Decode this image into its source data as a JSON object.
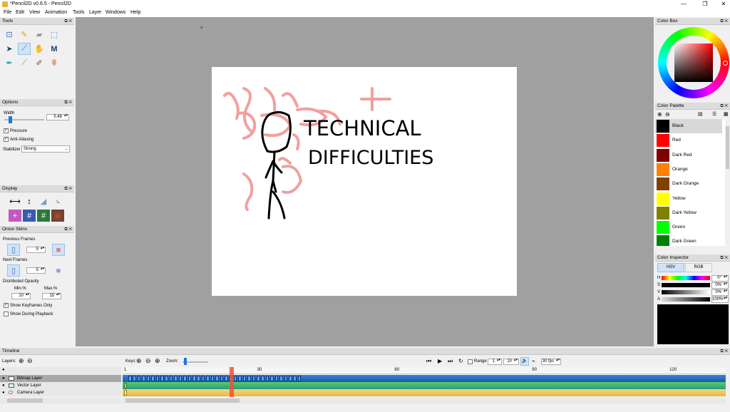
{
  "window": {
    "title": "*Pencil2D v0.6.5 - Pencil2D"
  },
  "menu": [
    "File",
    "Edit",
    "View",
    "Animation",
    "Tools",
    "Layer",
    "Windows",
    "Help"
  ],
  "tools_panel": {
    "title": "Tools"
  },
  "options_panel": {
    "title": "Options",
    "width_label": "Width",
    "width_value": "5.48",
    "width_level": 0.1,
    "pressure_label": "Pressure",
    "pressure_checked": true,
    "antialiasing_label": "Anti-Aliasing",
    "antialiasing_checked": true,
    "stabilizer_label": "Stabilizer",
    "stabilizer_value": "Strong"
  },
  "display_panel": {
    "title": "Display"
  },
  "onion_panel": {
    "title": "Onion Skins",
    "previous_label": "Previous Frames",
    "previous_value": "5",
    "next_label": "Next Frames",
    "next_value": "5",
    "distributed_label": "Distributed Opacity",
    "min_label": "Min.%",
    "min_value": "10",
    "max_label": "Max.%",
    "max_value": "15",
    "keyframes_only_label": "Show Keyframes Only",
    "keyframes_only_checked": true,
    "during_playback_label": "Show During Playback",
    "during_playback_checked": false
  },
  "canvas_text": {
    "line1": "TECHNICAL",
    "line2": "DIFFICULTIES"
  },
  "color_box": {
    "title": "Color Box"
  },
  "color_palette": {
    "title": "Color Palette",
    "colors": [
      {
        "name": "Black",
        "hex": "#000000"
      },
      {
        "name": "Red",
        "hex": "#ff0000"
      },
      {
        "name": "Dark Red",
        "hex": "#800000"
      },
      {
        "name": "Orange",
        "hex": "#ff8000"
      },
      {
        "name": "Dark Orange",
        "hex": "#804000"
      },
      {
        "name": "Yellow",
        "hex": "#ffff00"
      },
      {
        "name": "Dark Yellow",
        "hex": "#808000"
      },
      {
        "name": "Green",
        "hex": "#00ff00"
      },
      {
        "name": "Dark Green",
        "hex": "#008000"
      }
    ]
  },
  "color_inspector": {
    "title": "Color Inspector",
    "tab_hsv": "HSV",
    "tab_rgb": "RGB",
    "h_label": "H",
    "h_value": "0°",
    "s_label": "S",
    "s_value": "0%",
    "v_label": "V",
    "v_value": "0%",
    "a_label": "A",
    "a_value": "100%"
  },
  "timeline": {
    "title": "Timeline",
    "layers_label": "Layers:",
    "keys_label": "Keys:",
    "zoom_label": "Zoom:",
    "range_label": "Range",
    "range_start": "1",
    "range_end": "10",
    "fps_value": "30 fps",
    "current_frame": 24,
    "ruler": [
      "1",
      "30",
      "60",
      "90",
      "120"
    ],
    "layers": [
      {
        "name": "Bitmap Layer"
      },
      {
        "name": "Vector Layer"
      },
      {
        "name": "Camera Layer"
      }
    ]
  }
}
